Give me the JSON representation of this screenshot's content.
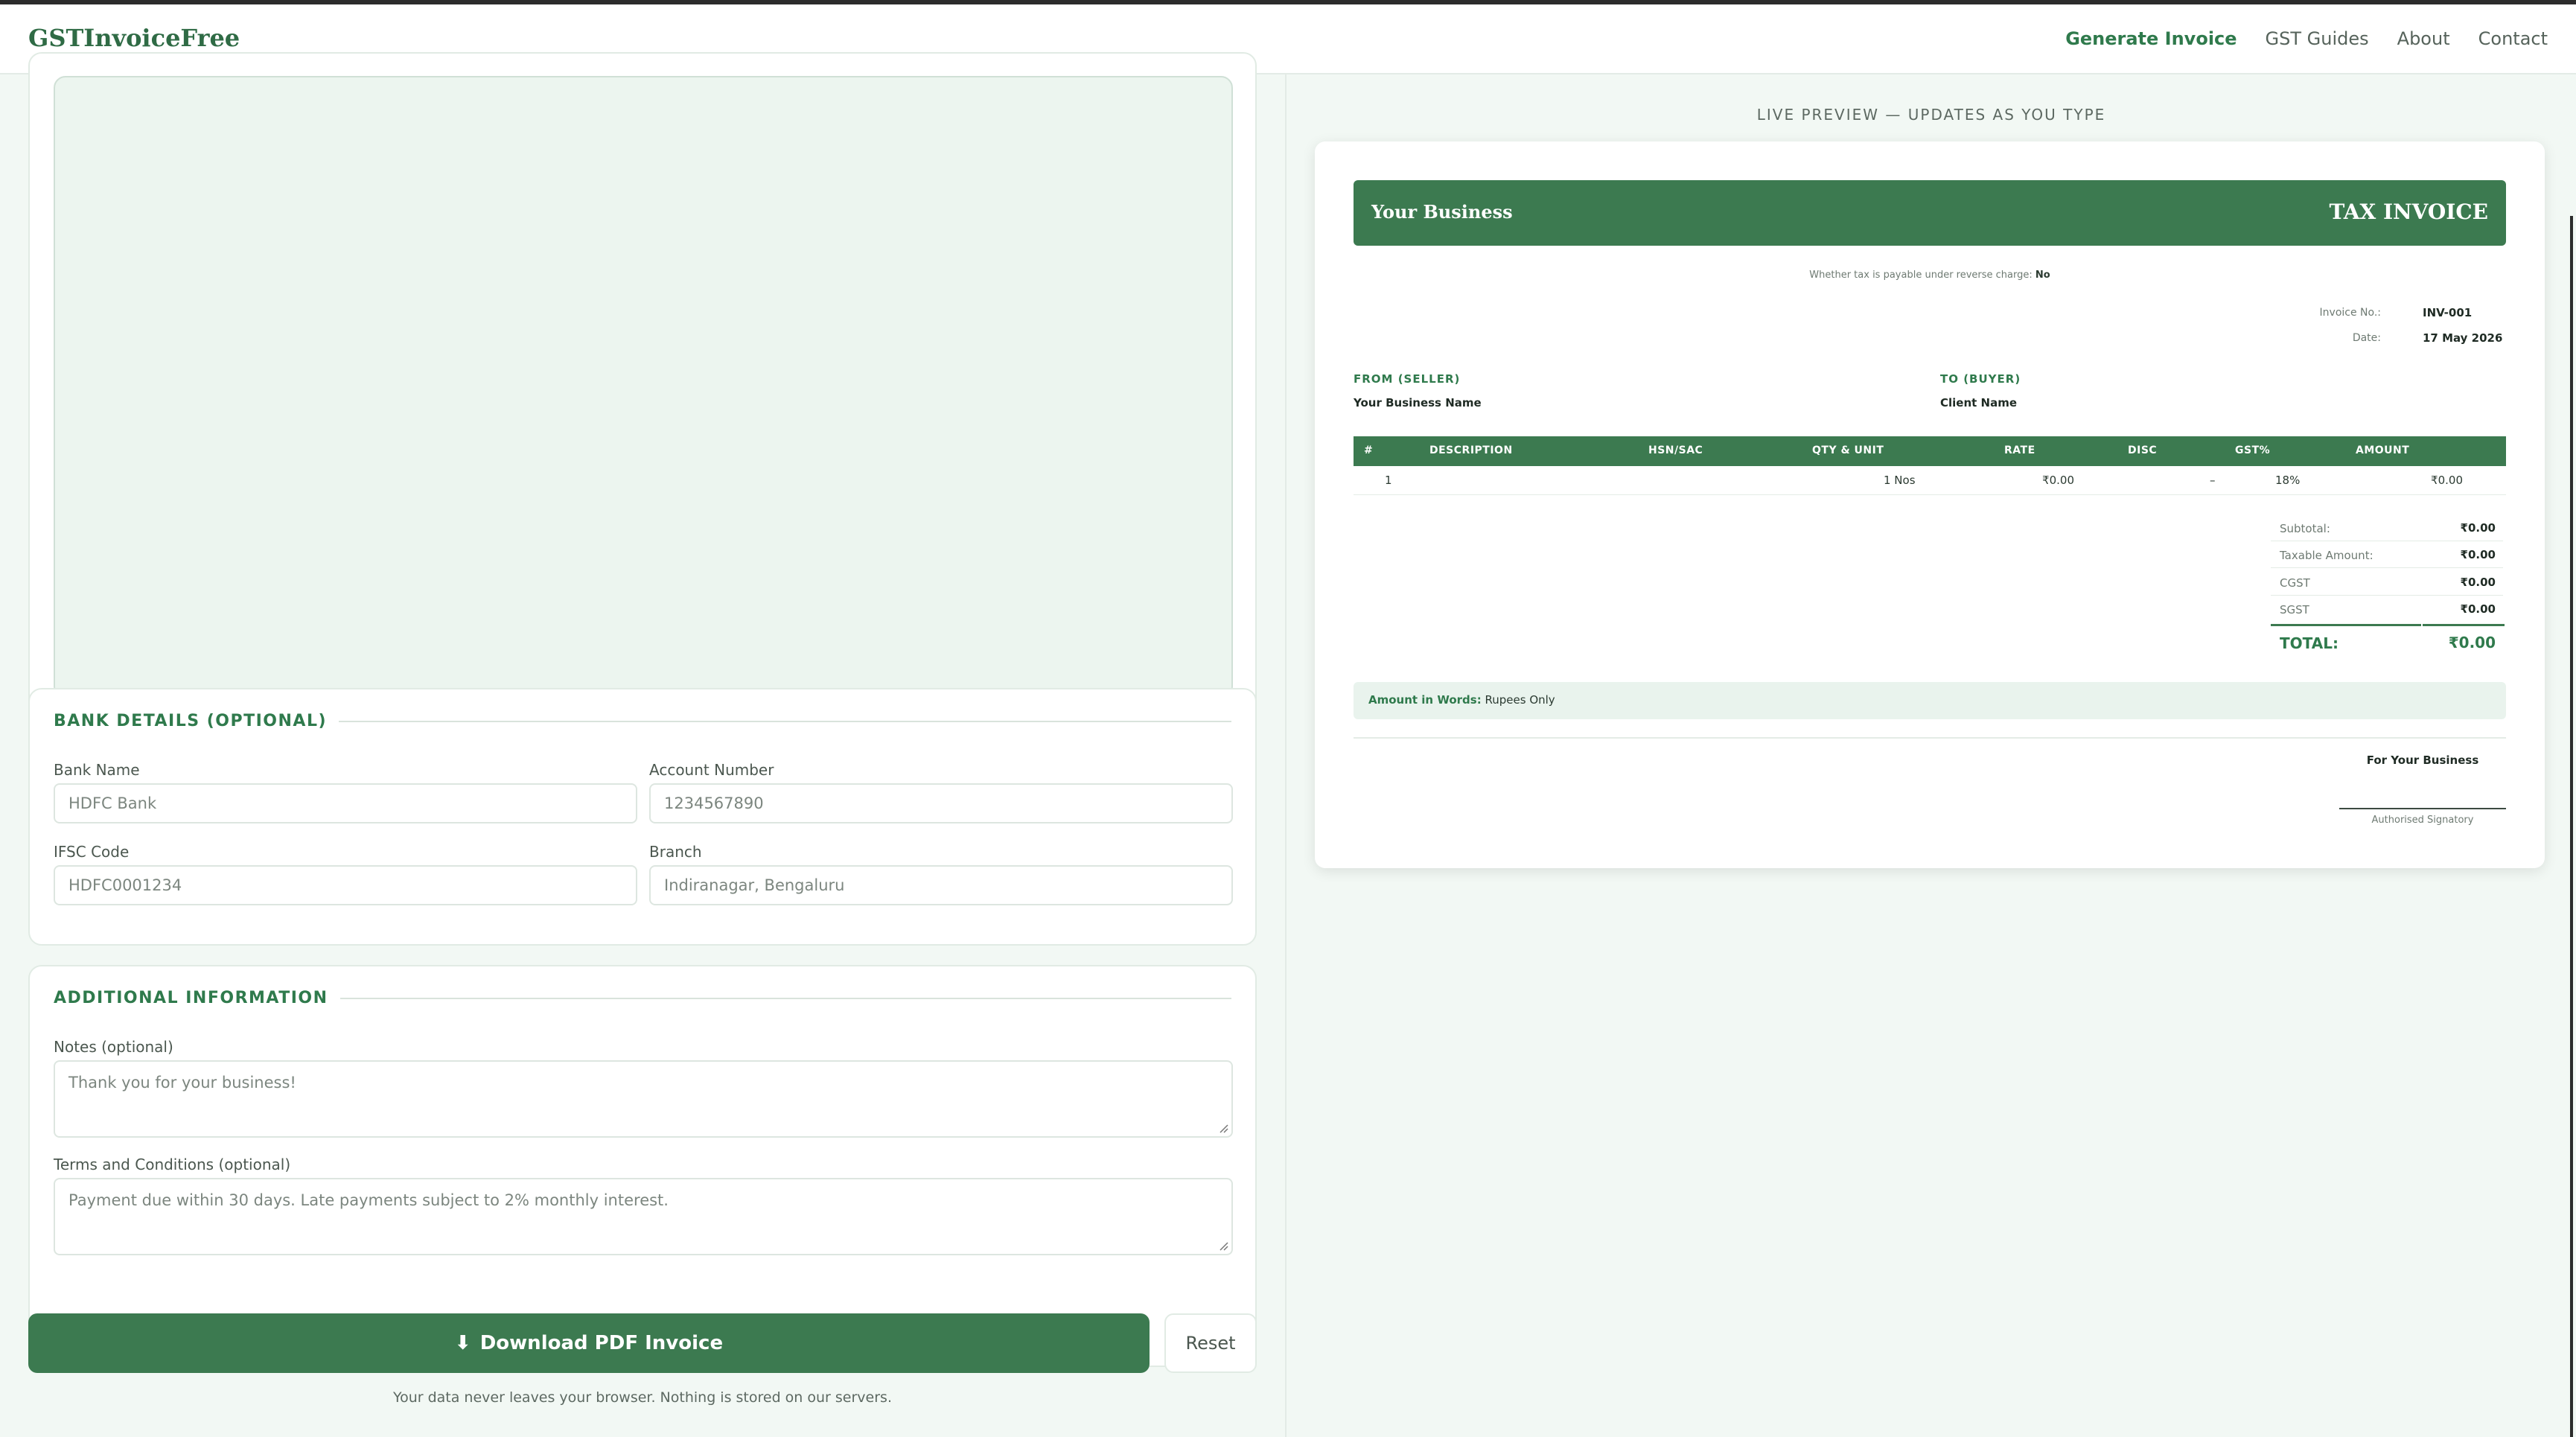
{
  "header": {
    "logo": "GSTInvoiceFree",
    "nav": [
      "Generate Invoice",
      "GST Guides",
      "About",
      "Contact"
    ]
  },
  "bank": {
    "title": "BANK DETAILS (OPTIONAL)",
    "bank_name_label": "Bank Name",
    "bank_name_placeholder": "HDFC Bank",
    "account_label": "Account Number",
    "account_placeholder": "1234567890",
    "ifsc_label": "IFSC Code",
    "ifsc_placeholder": "HDFC0001234",
    "branch_label": "Branch",
    "branch_placeholder": "Indiranagar, Bengaluru"
  },
  "additional": {
    "title": "ADDITIONAL INFORMATION",
    "notes_label": "Notes (optional)",
    "notes_placeholder": "Thank you for your business!",
    "terms_label": "Terms and Conditions (optional)",
    "terms_placeholder": "Payment due within 30 days. Late payments subject to 2% monthly interest."
  },
  "actions": {
    "download_icon": "⬇",
    "download_label": "Download PDF Invoice",
    "reset_label": "Reset",
    "privacy_note": "Your data never leaves your browser. Nothing is stored on our servers."
  },
  "preview": {
    "label": "LIVE PREVIEW — UPDATES AS YOU TYPE",
    "business": "Your Business",
    "title": "TAX INVOICE",
    "reverse_charge_text": "Whether tax is payable under reverse charge:",
    "reverse_charge_value": "No",
    "invoice_no_label": "Invoice No.:",
    "invoice_no": "INV-001",
    "date_label": "Date:",
    "date": "17 May 2026",
    "seller_heading": "FROM (SELLER)",
    "seller_name": "Your Business Name",
    "buyer_heading": "TO (BUYER)",
    "buyer_name": "Client Name",
    "columns": [
      "#",
      "DESCRIPTION",
      "HSN/SAC",
      "QTY & UNIT",
      "RATE",
      "DISC",
      "GST%",
      "AMOUNT"
    ],
    "row": {
      "index": "1",
      "description": "",
      "hsn": "",
      "qty_unit": "1 Nos",
      "rate": "₹0.00",
      "disc": "–",
      "gst": "18%",
      "amount": "₹0.00"
    },
    "totals": {
      "subtotal_label": "Subtotal:",
      "subtotal": "₹0.00",
      "taxable_label": "Taxable Amount:",
      "taxable": "₹0.00",
      "cgst_label": "CGST",
      "cgst": "₹0.00",
      "sgst_label": "SGST",
      "sgst": "₹0.00",
      "total_label": "TOTAL:",
      "total": "₹0.00"
    },
    "words_label": "Amount in Words:",
    "words_value": "Rupees Only",
    "for_business": "For Your Business",
    "signatory": "Authorised Signatory"
  },
  "colors": {
    "brand": "#3c7a50",
    "brand_text": "#2f7a4c",
    "page_bg": "#f2f8f4"
  }
}
